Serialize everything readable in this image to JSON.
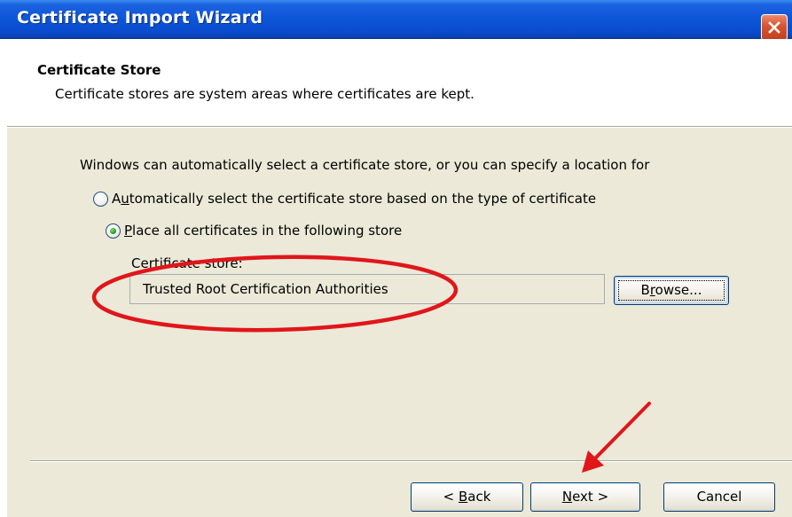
{
  "window": {
    "title": "Certificate Import Wizard",
    "close_icon": "close-icon"
  },
  "header": {
    "title": "Certificate Store",
    "subtitle": "Certificate stores are system areas where certificates are kept."
  },
  "body": {
    "intro": "Windows can automatically select a certificate store, or you can specify a location for",
    "options": [
      {
        "label_prefix": "A",
        "label_accel": "u",
        "label_rest": "tomatically select the certificate store based on the type of certificate",
        "selected": false
      },
      {
        "label_prefix": "",
        "label_accel": "P",
        "label_rest": "lace all certificates in the following store",
        "selected": true
      }
    ],
    "store": {
      "label": "Certificate store:",
      "value": "Trusted Root Certification Authorities",
      "browse_prefix": "B",
      "browse_accel": "r",
      "browse_rest": "owse..."
    }
  },
  "footer": {
    "back_prefix": "< ",
    "back_accel": "B",
    "back_rest": "ack",
    "next_accel": "N",
    "next_rest": "ext >",
    "cancel_label": "Cancel"
  },
  "annotations": {
    "ellipse_color": "#e0161b",
    "arrow_color": "#e0161b"
  }
}
